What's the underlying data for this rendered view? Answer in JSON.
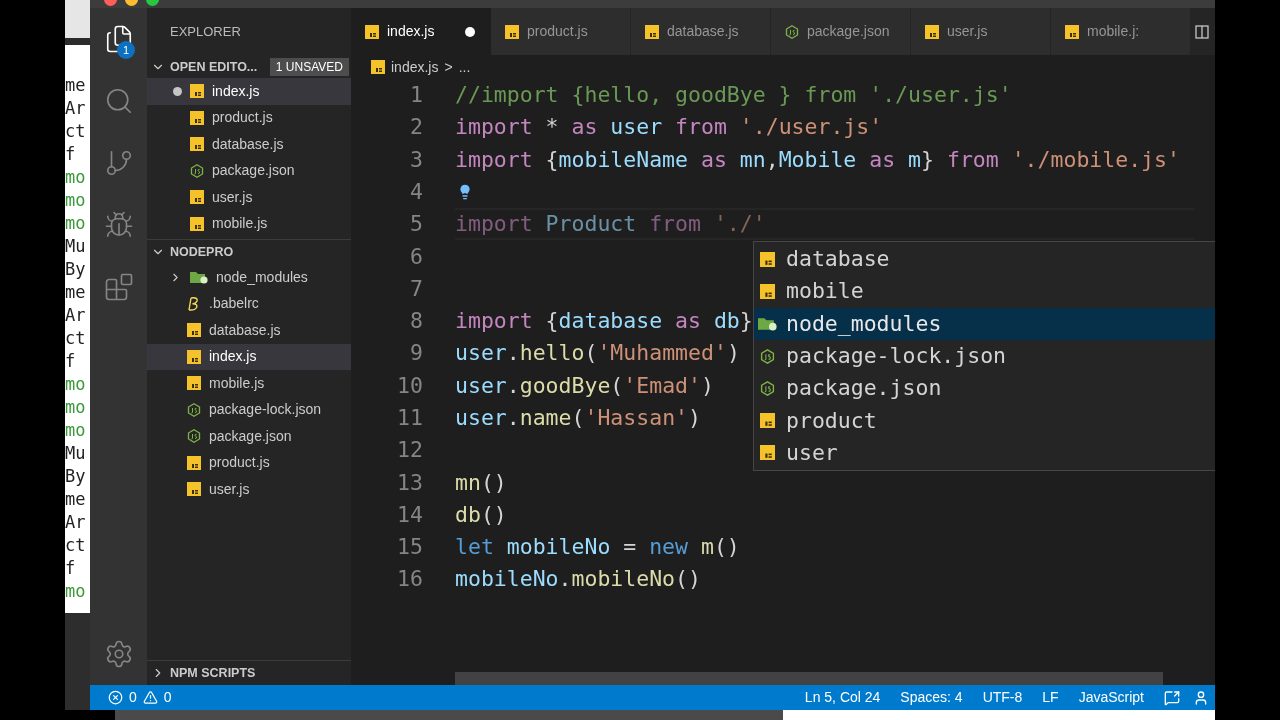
{
  "background_terminal": {
    "lines": [
      {
        "text": "me",
        "color": "#222222"
      },
      {
        "text": "Ar",
        "color": "#222222"
      },
      {
        "text": "ct",
        "color": "#222222"
      },
      {
        "text": "f",
        "color": "#222222"
      },
      {
        "text": "mo",
        "color": "#3a9a3a"
      },
      {
        "text": "mo",
        "color": "#3a9a3a"
      },
      {
        "text": "mo",
        "color": "#3a9a3a"
      },
      {
        "text": "Mu",
        "color": "#222222"
      },
      {
        "text": "By",
        "color": "#222222"
      },
      {
        "text": "me",
        "color": "#222222"
      },
      {
        "text": "Ar",
        "color": "#222222"
      },
      {
        "text": "ct",
        "color": "#222222"
      },
      {
        "text": "f",
        "color": "#222222"
      },
      {
        "text": "mo",
        "color": "#3a9a3a"
      },
      {
        "text": "mo",
        "color": "#3a9a3a"
      },
      {
        "text": "mo",
        "color": "#3a9a3a"
      },
      {
        "text": "Mu",
        "color": "#222222"
      },
      {
        "text": "By",
        "color": "#222222"
      },
      {
        "text": "me",
        "color": "#222222"
      },
      {
        "text": "Ar",
        "color": "#222222"
      },
      {
        "text": "ct",
        "color": "#222222"
      },
      {
        "text": "f",
        "color": "#222222"
      },
      {
        "text": "mo",
        "color": "#3a9a3a"
      }
    ]
  },
  "activity_bar": {
    "items": [
      {
        "kind": "explorer",
        "selected": true,
        "badge": "1"
      },
      {
        "kind": "search",
        "selected": false
      },
      {
        "kind": "source-control",
        "selected": false
      },
      {
        "kind": "debug",
        "selected": false
      },
      {
        "kind": "extensions",
        "selected": false
      }
    ]
  },
  "sidebar": {
    "title": "EXPLORER",
    "open_editors": {
      "label": "OPEN EDITO...",
      "badge": "1 UNSAVED",
      "expanded": true,
      "items": [
        {
          "name": "index.js",
          "kind": "js",
          "selected": true,
          "dirty": true
        },
        {
          "name": "product.js",
          "kind": "js",
          "selected": false,
          "dirty": false
        },
        {
          "name": "database.js",
          "kind": "js",
          "selected": false,
          "dirty": false
        },
        {
          "name": "package.json",
          "kind": "json",
          "selected": false,
          "dirty": false
        },
        {
          "name": "user.js",
          "kind": "js",
          "selected": false,
          "dirty": false
        },
        {
          "name": "mobile.js",
          "kind": "js",
          "selected": false,
          "dirty": false
        }
      ]
    },
    "project": {
      "label": "NODEPRO",
      "expanded": true,
      "items": [
        {
          "name": "node_modules",
          "kind": "folder",
          "selected": false,
          "expanded": false
        },
        {
          "name": ".babelrc",
          "kind": "babel",
          "selected": false
        },
        {
          "name": "database.js",
          "kind": "js",
          "selected": false
        },
        {
          "name": "index.js",
          "kind": "js",
          "selected": true
        },
        {
          "name": "mobile.js",
          "kind": "js",
          "selected": false
        },
        {
          "name": "package-lock.json",
          "kind": "json",
          "selected": false
        },
        {
          "name": "package.json",
          "kind": "json",
          "selected": false
        },
        {
          "name": "product.js",
          "kind": "js",
          "selected": false
        },
        {
          "name": "user.js",
          "kind": "js",
          "selected": false
        }
      ]
    },
    "npm_scripts": {
      "label": "NPM SCRIPTS",
      "expanded": false
    }
  },
  "tabs": [
    {
      "label": "index.js",
      "kind": "js",
      "selected": true,
      "dirty": true
    },
    {
      "label": "product.js",
      "kind": "js",
      "selected": false,
      "dirty": false
    },
    {
      "label": "database.js",
      "kind": "js",
      "selected": false,
      "dirty": false
    },
    {
      "label": "package.json",
      "kind": "json",
      "selected": false,
      "dirty": false
    },
    {
      "label": "user.js",
      "kind": "js",
      "selected": false,
      "dirty": false
    },
    {
      "label": "mobile.j:",
      "kind": "js",
      "selected": false,
      "dirty": false
    }
  ],
  "breadcrumbs": {
    "file": "index.js",
    "kind": "js",
    "separator": ">",
    "more": "..."
  },
  "editor": {
    "lines": [
      {
        "n": "1",
        "tokens": [
          {
            "kind": "comment",
            "t": "//import {hello, goodBye } from './user.js'"
          }
        ]
      },
      {
        "n": "2",
        "tokens": [
          {
            "kind": "keyword",
            "t": "import "
          },
          {
            "kind": "punct",
            "t": "* "
          },
          {
            "kind": "keyword",
            "t": "as "
          },
          {
            "kind": "var",
            "t": "user "
          },
          {
            "kind": "keyword",
            "t": "from "
          },
          {
            "kind": "string",
            "t": "'./user.js'"
          }
        ]
      },
      {
        "n": "3",
        "tokens": [
          {
            "kind": "keyword",
            "t": "import "
          },
          {
            "kind": "punct",
            "t": "{"
          },
          {
            "kind": "var",
            "t": "mobileName "
          },
          {
            "kind": "keyword",
            "t": "as "
          },
          {
            "kind": "var",
            "t": "mn"
          },
          {
            "kind": "punct",
            "t": ","
          },
          {
            "kind": "var",
            "t": "Mobile "
          },
          {
            "kind": "keyword",
            "t": "as "
          },
          {
            "kind": "var",
            "t": "m"
          },
          {
            "kind": "punct",
            "t": "} "
          },
          {
            "kind": "keyword",
            "t": "from "
          },
          {
            "kind": "string",
            "t": "'./mobile.js'"
          }
        ]
      },
      {
        "n": "4",
        "lightbulb": true
      },
      {
        "n": "5",
        "current": true,
        "tokens": [
          {
            "kind": "keyword",
            "t": "import "
          },
          {
            "kind": "var",
            "t": "Product "
          },
          {
            "kind": "keyword",
            "t": "from "
          },
          {
            "kind": "string",
            "t": "'./'"
          }
        ]
      },
      {
        "n": "6"
      },
      {
        "n": "7"
      },
      {
        "n": "8",
        "tokens": [
          {
            "kind": "keyword",
            "t": "import "
          },
          {
            "kind": "punct",
            "t": "{"
          },
          {
            "kind": "var",
            "t": "database "
          },
          {
            "kind": "keyword",
            "t": "as "
          },
          {
            "kind": "var",
            "t": "db"
          },
          {
            "kind": "punct",
            "t": "}"
          }
        ]
      },
      {
        "n": "9",
        "tokens": [
          {
            "kind": "var",
            "t": "user"
          },
          {
            "kind": "punct",
            "t": "."
          },
          {
            "kind": "func",
            "t": "hello"
          },
          {
            "kind": "punct",
            "t": "("
          },
          {
            "kind": "string",
            "t": "'Muhammed'"
          },
          {
            "kind": "punct",
            "t": ")"
          }
        ]
      },
      {
        "n": "10",
        "tokens": [
          {
            "kind": "var",
            "t": "user"
          },
          {
            "kind": "punct",
            "t": "."
          },
          {
            "kind": "func",
            "t": "goodBye"
          },
          {
            "kind": "punct",
            "t": "("
          },
          {
            "kind": "string",
            "t": "'Emad'"
          },
          {
            "kind": "punct",
            "t": ")"
          }
        ]
      },
      {
        "n": "11",
        "tokens": [
          {
            "kind": "var",
            "t": "user"
          },
          {
            "kind": "punct",
            "t": "."
          },
          {
            "kind": "func",
            "t": "name"
          },
          {
            "kind": "punct",
            "t": "("
          },
          {
            "kind": "string",
            "t": "'Hassan'"
          },
          {
            "kind": "punct",
            "t": ")"
          }
        ]
      },
      {
        "n": "12"
      },
      {
        "n": "13",
        "tokens": [
          {
            "kind": "func",
            "t": "mn"
          },
          {
            "kind": "punct",
            "t": "()"
          }
        ]
      },
      {
        "n": "14",
        "tokens": [
          {
            "kind": "func",
            "t": "db"
          },
          {
            "kind": "punct",
            "t": "()"
          }
        ]
      },
      {
        "n": "15",
        "tokens": [
          {
            "kind": "storage",
            "t": "let "
          },
          {
            "kind": "var",
            "t": "mobileNo "
          },
          {
            "kind": "punct",
            "t": "= "
          },
          {
            "kind": "storage",
            "t": "new "
          },
          {
            "kind": "func",
            "t": "m"
          },
          {
            "kind": "punct",
            "t": "()"
          }
        ]
      },
      {
        "n": "16",
        "tokens": [
          {
            "kind": "var",
            "t": "mobileNo"
          },
          {
            "kind": "punct",
            "t": "."
          },
          {
            "kind": "func",
            "t": "mobileNo"
          },
          {
            "kind": "punct",
            "t": "()"
          }
        ]
      }
    ],
    "suggestions": [
      {
        "label": "database",
        "kind": "js",
        "selected": false
      },
      {
        "label": "mobile",
        "kind": "js",
        "selected": false
      },
      {
        "label": "node_modules",
        "kind": "folder",
        "selected": true
      },
      {
        "label": "package-lock.json",
        "kind": "json",
        "selected": false
      },
      {
        "label": "package.json",
        "kind": "json",
        "selected": false
      },
      {
        "label": "product",
        "kind": "js",
        "selected": false
      },
      {
        "label": "user",
        "kind": "js",
        "selected": false
      }
    ]
  },
  "status_bar": {
    "errors": "0",
    "warnings": "0",
    "right": [
      "Ln 5, Col 24",
      "Spaces: 4",
      "UTF-8",
      "LF",
      "JavaScript"
    ]
  }
}
